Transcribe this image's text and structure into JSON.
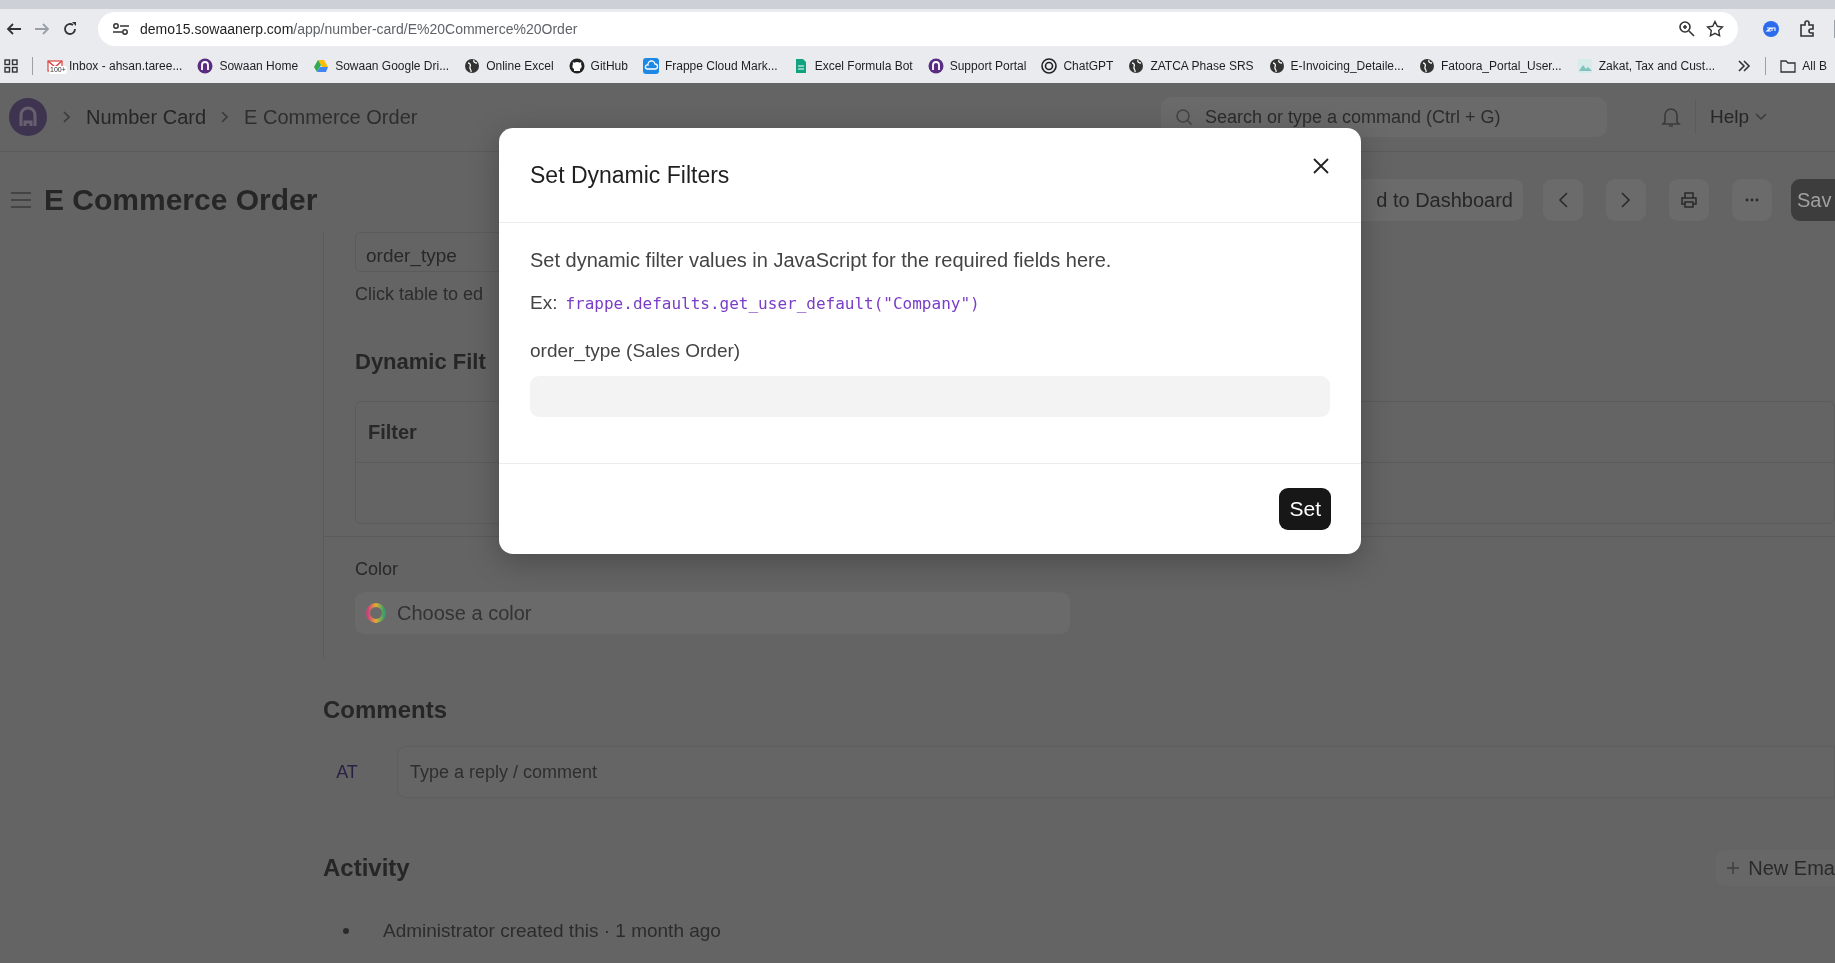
{
  "browser": {
    "url_host": "demo15.sowaanerp.com",
    "url_path": "/app/number-card/E%20Commerce%20Order",
    "bookmarks": [
      {
        "kind": "mail",
        "label": "Inbox - ahsan.taree...",
        "badge": "100+"
      },
      {
        "kind": "logo",
        "label": "Sowaan Home"
      },
      {
        "kind": "drive",
        "label": "Sowaan Google Dri..."
      },
      {
        "kind": "globe",
        "label": "Online Excel"
      },
      {
        "kind": "cat",
        "label": "GitHub"
      },
      {
        "kind": "cloud",
        "label": "Frappe Cloud Mark..."
      },
      {
        "kind": "sheet",
        "label": "Excel Formula Bot"
      },
      {
        "kind": "logo",
        "label": "Support Portal"
      },
      {
        "kind": "knot",
        "label": "ChatGPT"
      },
      {
        "kind": "globe",
        "label": "ZATCA Phase SRS"
      },
      {
        "kind": "globe",
        "label": "E-Invoicing_Detaile..."
      },
      {
        "kind": "globe",
        "label": "Fatoora_Portal_User..."
      },
      {
        "kind": "image",
        "label": "Zakat, Tax and Cust..."
      }
    ],
    "all_bookmarks": "All B"
  },
  "navbar": {
    "breadcrumbs": [
      "Number Card",
      "E Commerce Order"
    ],
    "search_placeholder": "Search or type a command (Ctrl + G)",
    "help": "Help"
  },
  "page_header": {
    "title": "E Commerce Order",
    "add_button": "d to Dashboard",
    "save_button": "Sav"
  },
  "form": {
    "field_value": "order_type",
    "hint": "Click table to ed",
    "section_title": "Dynamic Filt",
    "table": {
      "columns": [
        "Filter"
      ]
    },
    "color_label": "Color",
    "color_placeholder": "Choose a color"
  },
  "comments": {
    "title": "Comments",
    "avatar": "AT",
    "placeholder": "Type a reply / comment"
  },
  "activity": {
    "title": "Activity",
    "new_email": "New Ema",
    "items": [
      "Administrator created this · 1 month ago"
    ]
  },
  "modal": {
    "title": "Set Dynamic Filters",
    "description": "Set dynamic filter values in JavaScript for the required fields here.",
    "example_label": "Ex:",
    "example_code": "frappe.defaults.get_user_default(\"Company\")",
    "fields": [
      {
        "label": "order_type (Sales Order)"
      }
    ],
    "primary_button": "Set"
  }
}
